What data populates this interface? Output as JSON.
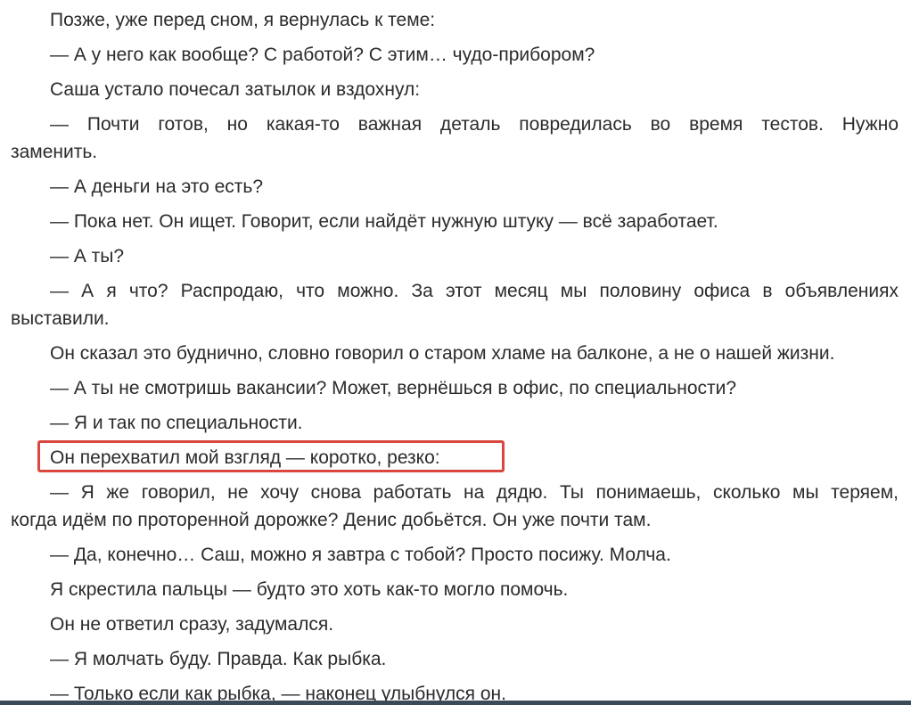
{
  "lines": [
    "Позже, уже перед сном, я вернулась к теме:",
    "— А у него как вообще? С работой? С этим… чудо-прибором?",
    "Саша устало почесал затылок и вздохнул:",
    "— Почти готов, но какая-то важная деталь повредилась во время тестов. Нужно",
    "заменить.",
    "— А деньги на это есть?",
    "— Пока нет. Он ищет. Говорит, если найдёт нужную штуку — всё заработает.",
    "— А ты?",
    "— А я что? Распродаю, что можно. За этот месяц мы половину офиса в объявлениях",
    "выставили.",
    "Он сказал это буднично, словно говорил о старом хламе на балконе, а не о нашей жизни.",
    "— А ты не смотришь вакансии? Может, вернёшься в офис, по специальности?",
    "— Я и так по специальности.",
    "Он перехватил мой взгляд — коротко, резко:",
    "— Я же говорил, не хочу снова работать на дядю. Ты понимаешь, сколько мы теряем,",
    "когда идём по проторенной дорожке? Денис добьётся. Он уже почти там.",
    "— Да, конечно… Саш, можно я завтра с тобой? Просто посижу. Молча.",
    "Я скрестила пальцы — будто это хоть как-то могло помочь.",
    "Он не ответил сразу, задумался.",
    "— Я молчать буду. Правда. Как рыбка.",
    "— Только если как рыбка, — наконец улыбнулся он."
  ],
  "highlight_color": "#d9473f"
}
